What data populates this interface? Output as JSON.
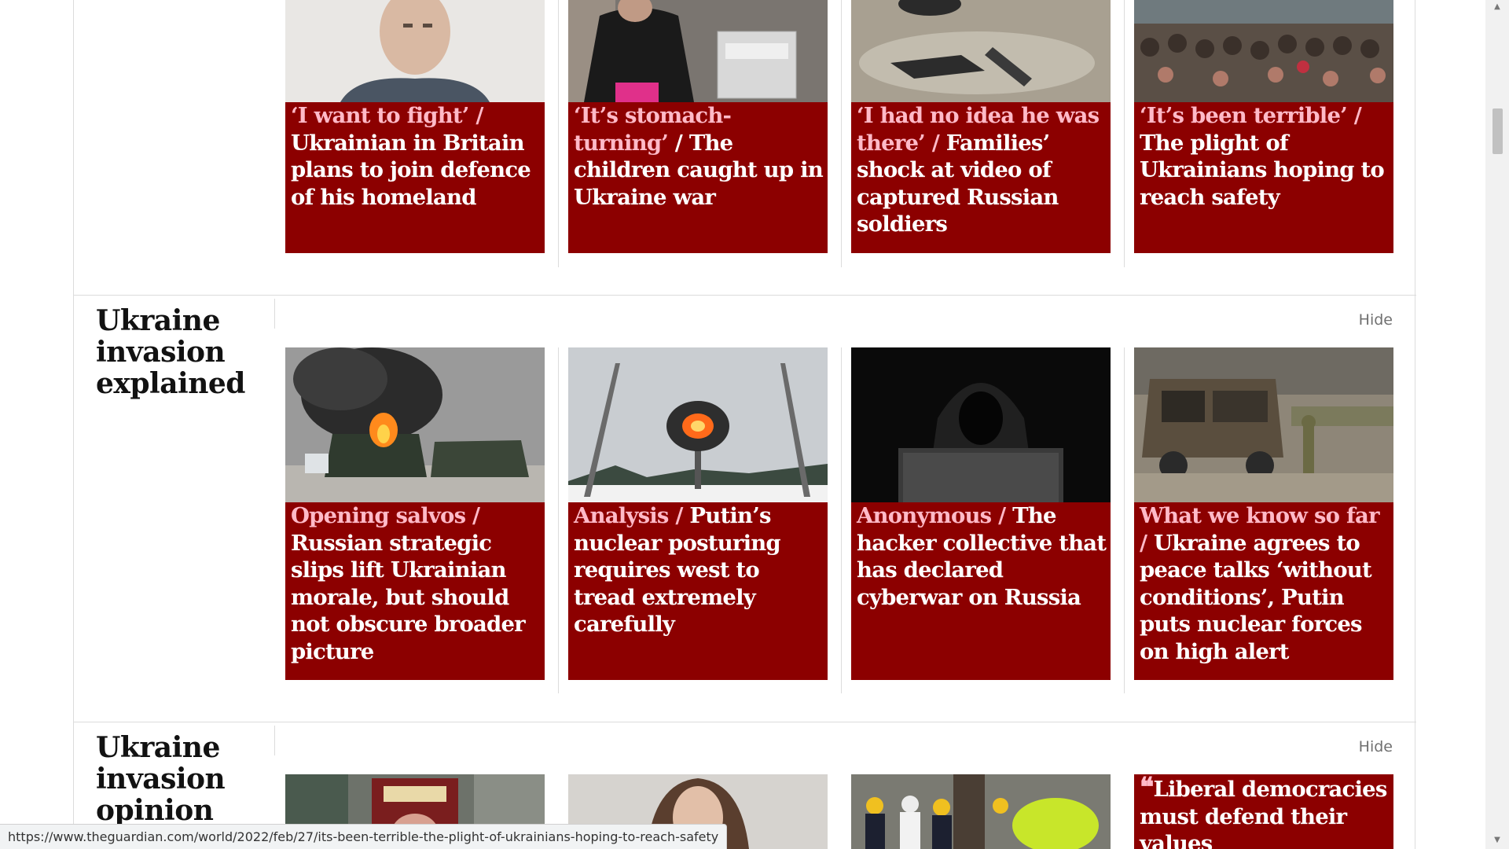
{
  "top_row": [
    {
      "kicker": "‘I want to fight’ /",
      "headline": " Ukrainian in Britain plans to join defence of his homeland",
      "image": "portrait-man"
    },
    {
      "kicker": "‘It’s stomach-turning’",
      "headline": " / The children caught up in Ukraine war",
      "image": "woman-with-bag"
    },
    {
      "kicker": "‘I had no idea he was there’ /",
      "headline": " Families’ shock at video of captured Russian soldiers",
      "image": "debris-on-ground"
    },
    {
      "kicker": "‘It’s been terrible’ /",
      "headline": " The plight of Ukrainians hoping to reach safety",
      "image": "crowd-at-station"
    }
  ],
  "sections": [
    {
      "title": "Ukraine invasion explained",
      "hide_label": "Hide",
      "cards": [
        {
          "kicker": "Opening salvos /",
          "headline": " Russian strategic slips lift Ukrainian morale, but should not obscure broader picture",
          "image": "burning-vehicles"
        },
        {
          "kicker": "Analysis /",
          "headline": " Putin’s nuclear posturing requires west to tread extremely carefully",
          "image": "missile-explosion"
        },
        {
          "kicker": "Anonymous /",
          "headline": " The hacker collective that has declared cyberwar on Russia",
          "image": "hooded-hacker"
        },
        {
          "kicker": "What we know so far /",
          "headline": " Ukraine agrees to peace talks ‘without conditions’, Putin puts nuclear forces on high alert",
          "image": "destroyed-truck"
        }
      ]
    },
    {
      "title": "Ukraine invasion opinion",
      "hide_label": "Hide",
      "cards": [
        {
          "image": "time-magazine-poster"
        },
        {
          "image": "woman-portrait"
        },
        {
          "image": "emergency-workers"
        },
        {
          "quote_icon": "quote-icon",
          "headline": "Liberal democracies must defend their values"
        }
      ]
    }
  ],
  "status_url": "https://www.theguardian.com/world/2022/feb/27/its-been-terrible-the-plight-of-ukrainians-hoping-to-reach-safety",
  "colors": {
    "card_bg": "#8c0000",
    "kicker": "#ffbac8",
    "headline": "#ffffff"
  }
}
